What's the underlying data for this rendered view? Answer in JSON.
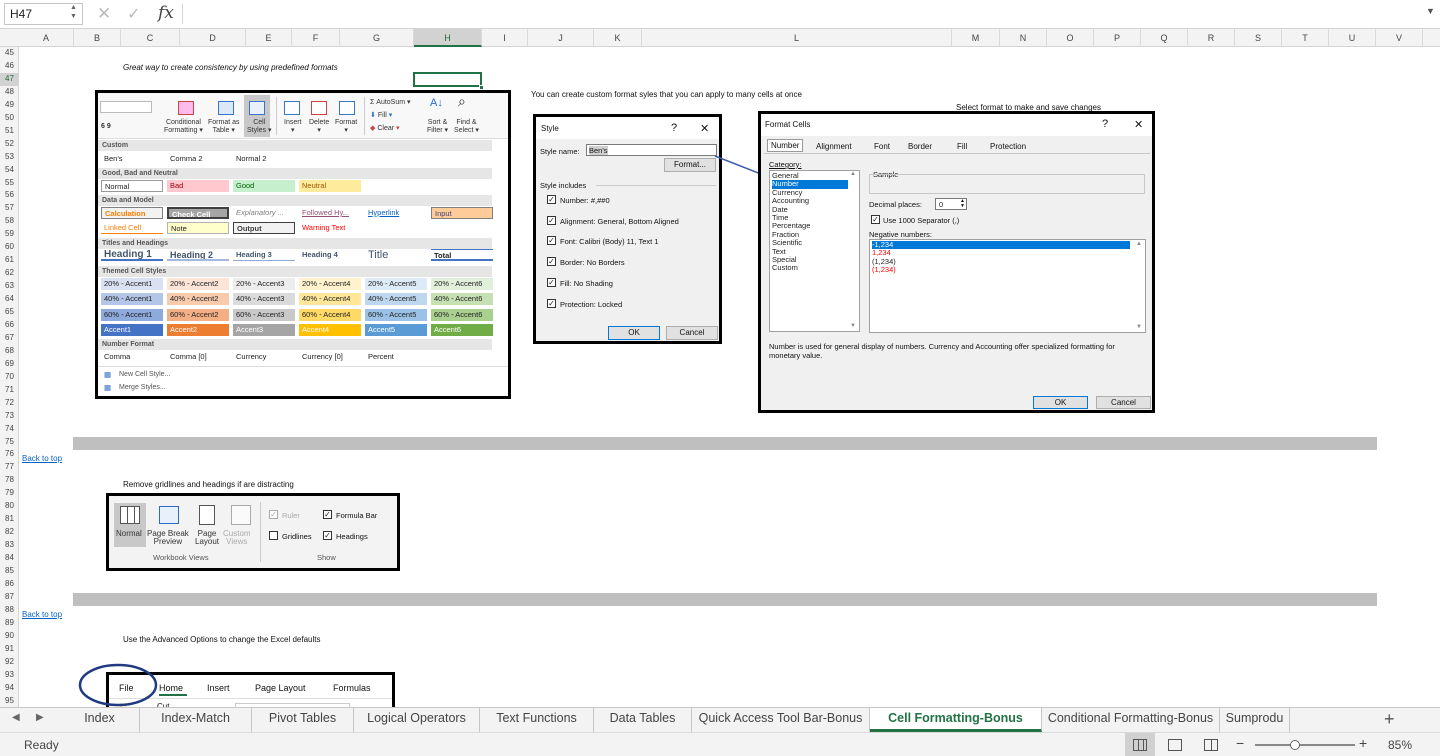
{
  "formula_bar": {
    "name_box": "H47",
    "fx": "fx",
    "formula": ""
  },
  "columns": [
    {
      "label": "A",
      "l": 19,
      "w": 55
    },
    {
      "label": "B",
      "l": 74,
      "w": 47
    },
    {
      "label": "C",
      "l": 121,
      "w": 59
    },
    {
      "label": "D",
      "l": 180,
      "w": 66
    },
    {
      "label": "E",
      "l": 246,
      "w": 46
    },
    {
      "label": "F",
      "l": 292,
      "w": 48
    },
    {
      "label": "G",
      "l": 340,
      "w": 74
    },
    {
      "label": "H",
      "l": 414,
      "w": 68,
      "sel": true
    },
    {
      "label": "I",
      "l": 482,
      "w": 46
    },
    {
      "label": "J",
      "l": 528,
      "w": 66
    },
    {
      "label": "K",
      "l": 594,
      "w": 48
    },
    {
      "label": "L",
      "l": 642,
      "w": 310
    },
    {
      "label": "M",
      "l": 952,
      "w": 48
    },
    {
      "label": "N",
      "l": 1000,
      "w": 47
    },
    {
      "label": "O",
      "l": 1047,
      "w": 47
    },
    {
      "label": "P",
      "l": 1094,
      "w": 47
    },
    {
      "label": "Q",
      "l": 1141,
      "w": 47
    },
    {
      "label": "R",
      "l": 1188,
      "w": 47
    },
    {
      "label": "S",
      "l": 1235,
      "w": 47
    },
    {
      "label": "T",
      "l": 1282,
      "w": 47
    },
    {
      "label": "U",
      "l": 1329,
      "w": 47
    },
    {
      "label": "V",
      "l": 1376,
      "w": 47
    }
  ],
  "rows": [
    "45",
    "46",
    "47",
    "48",
    "49",
    "50",
    "51",
    "52",
    "53",
    "54",
    "55",
    "56",
    "57",
    "58",
    "59",
    "60",
    "61",
    "62",
    "63",
    "64",
    "65",
    "66",
    "67",
    "68",
    "69",
    "70",
    "71",
    "72",
    "73",
    "74",
    "75",
    "76",
    "77",
    "78",
    "79",
    "80",
    "81",
    "82",
    "83",
    "84",
    "85",
    "86",
    "87",
    "88",
    "89",
    "90",
    "91",
    "92",
    "93",
    "94",
    "95"
  ],
  "notes": {
    "predefined": "Great way to create consistency by using predefined formats",
    "custom": "You can create custom format syles that you can apply to many cells at once",
    "select_format": "Select format to make and save changes",
    "back1": "Back to top",
    "gridlines": "Remove gridlines and headings if are distracting",
    "back2": "Back to top",
    "advanced": "Use the Advanced Options to change the Excel defaults"
  },
  "cell_styles_panel": {
    "ribbon": {
      "conditional": "Conditional",
      "formatting": "Formatting",
      "format_as": "Format as",
      "table": "Table",
      "cell": "Cell",
      "styles": "Styles",
      "insert": "Insert",
      "delete": "Delete",
      "format": "Format",
      "autosum": "AutoSum",
      "fill": "Fill",
      "clear": "Clear",
      "sort": "Sort &",
      "filter": "Filter",
      "find": "Find &",
      "select": "Select",
      "num": "6 9"
    },
    "sections": {
      "custom": "Custom",
      "gbn": "Good, Bad and Neutral",
      "dm": "Data and Model",
      "th": "Titles and Headings",
      "themed": "Themed Cell Styles",
      "nf": "Number Format"
    },
    "custom": [
      "Ben's",
      "Comma 2",
      "Normal 2"
    ],
    "gbn": [
      "Normal",
      "Bad",
      "Good",
      "Neutral"
    ],
    "dm1": [
      "Calculation",
      "Check Cell",
      "Explanatory ...",
      "Followed Hy...",
      "Hyperlink",
      "Input"
    ],
    "dm2": [
      "Linked Cell",
      "Note",
      "Output",
      "Warning Text"
    ],
    "th": [
      "Heading 1",
      "Heading 2",
      "Heading 3",
      "Heading 4",
      "Title",
      "Total"
    ],
    "themed20": [
      "20% - Accent1",
      "20% - Accent2",
      "20% - Accent3",
      "20% - Accent4",
      "20% - Accent5",
      "20% - Accent6"
    ],
    "themed40": [
      "40% - Accent1",
      "40% - Accent2",
      "40% - Accent3",
      "40% - Accent4",
      "40% - Accent5",
      "40% - Accent6"
    ],
    "themed60": [
      "60% - Accent1",
      "60% - Accent2",
      "60% - Accent3",
      "60% - Accent4",
      "60% - Accent5",
      "60% - Accent6"
    ],
    "accent": [
      "Accent1",
      "Accent2",
      "Accent3",
      "Accent4",
      "Accent5",
      "Accent6"
    ],
    "nf": [
      "Comma",
      "Comma [0]",
      "Currency",
      "Currency [0]",
      "Percent"
    ],
    "new_style": "New Cell Style...",
    "merge": "Merge Styles..."
  },
  "style_dialog": {
    "title": "Style",
    "help": "?",
    "close": "✕",
    "style_name_label": "Style name:",
    "style_name": "Ben's",
    "format_btn": "Format...",
    "includes": "Style includes",
    "items": [
      "Number: #,##0",
      "Alignment: General, Bottom Aligned",
      "Font: Calibri (Body) 11, Text 1",
      "Border: No Borders",
      "Fill: No Shading",
      "Protection: Locked"
    ],
    "ok": "OK",
    "cancel": "Cancel"
  },
  "format_cells": {
    "title": "Format Cells",
    "help": "?",
    "close": "✕",
    "tabs": [
      "Number",
      "Alignment",
      "Font",
      "Border",
      "Fill",
      "Protection"
    ],
    "category_label": "Category:",
    "categories": [
      "General",
      "Number",
      "Currency",
      "Accounting",
      "Date",
      "Time",
      "Percentage",
      "Fraction",
      "Scientific",
      "Text",
      "Special",
      "Custom"
    ],
    "sample": "Sample",
    "decimal_label": "Decimal places:",
    "decimal": "0",
    "separator": "Use 1000 Separator (,)",
    "negative_label": "Negative numbers:",
    "negatives": [
      "-1,234",
      "1,234",
      "(1,234)",
      "(1,234)"
    ],
    "desc": "Number is used for general display of numbers.  Currency and Accounting offer specialized formatting for monetary value.",
    "ok": "OK",
    "cancel": "Cancel"
  },
  "view_ribbon": {
    "normal": "Normal",
    "page_break": "Page Break",
    "preview": "Preview",
    "page": "Page",
    "layout": "Layout",
    "custom": "Custom",
    "views": "Views",
    "workbook_views": "Workbook Views",
    "ruler": "Ruler",
    "formula_bar": "Formula Bar",
    "gridlines": "Gridlines",
    "headings": "Headings",
    "show": "Show"
  },
  "file_ribbon": {
    "file": "File",
    "home": "Home",
    "insert": "Insert",
    "page_layout": "Page Layout",
    "formulas": "Formulas",
    "cut": "Cut"
  },
  "sheet_tabs": [
    "Index",
    "Index-Match",
    "Pivot Tables",
    "Logical Operators",
    "Text Functions",
    "Data Tables",
    "Quick Access Tool Bar-Bonus",
    "Cell Formatting-Bonus",
    "Conditional Formatting-Bonus",
    "Sumprodu"
  ],
  "active_tab": "Cell Formatting-Bonus",
  "status": {
    "ready": "Ready",
    "zoom": "85%",
    "minus": "−",
    "plus": "+",
    "add_sheet": "+"
  }
}
